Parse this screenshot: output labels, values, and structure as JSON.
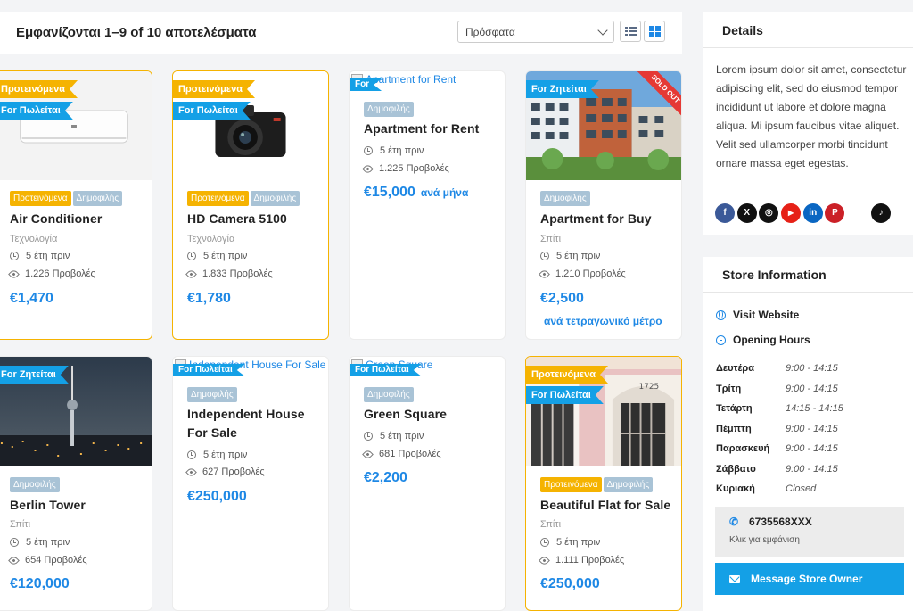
{
  "results": {
    "text": "Εμφανίζονται 1–9 of 10 αποτελέσματα"
  },
  "sort": {
    "selected": "Πρόσφατα"
  },
  "cards": [
    {
      "ribbons": [
        "Προτεινόμενα",
        "For Πωλείται"
      ],
      "tags": [
        "Προτεινόμενα",
        "Δημοφιλής"
      ],
      "title": "Air Conditioner",
      "category": "Τεχνολογία",
      "time": "5 έτη πριν",
      "views": "1.226 Προβολές",
      "price": "€1,470"
    },
    {
      "ribbons": [
        "Προτεινόμενα",
        "For Πωλείται"
      ],
      "tags": [
        "Προτεινόμενα",
        "Δημοφιλής"
      ],
      "title": "HD Camera 5100",
      "category": "Τεχνολογία",
      "time": "5 έτη πριν",
      "views": "1.833 Προβολές",
      "price": "€1,780"
    },
    {
      "broken_alt": "Apartment for Rent",
      "ribbons": [
        "For"
      ],
      "tags": [
        "Δημοφιλής"
      ],
      "title": "Apartment for Rent",
      "time": "5 έτη πριν",
      "views": "1.225 Προβολές",
      "price": "€15,000",
      "price_suffix": "ανά μήνα"
    },
    {
      "ribbons": [
        "For Ζητείται"
      ],
      "badge": "SOLD OUT",
      "tags": [
        "Δημοφιλής"
      ],
      "title": "Apartment for Buy",
      "category": "Σπίτι",
      "time": "5 έτη πριν",
      "views": "1.210 Προβολές",
      "price": "€2,500",
      "price_unit": "ανά τετραγωνικό μέτρο"
    },
    {
      "ribbons": [
        "For Ζητείται"
      ],
      "tags": [
        "Δημοφιλής"
      ],
      "title": "Berlin Tower",
      "category": "Σπίτι",
      "time": "5 έτη πριν",
      "views": "654 Προβολές",
      "price": "€120,000"
    },
    {
      "broken_alt": "Independent House For Sale",
      "ribbons": [
        "For Πωλείται"
      ],
      "tags": [
        "Δημοφιλής"
      ],
      "title_line1": "Independent House",
      "title_line2": "For Sale",
      "time": "5 έτη πριν",
      "views": "627 Προβολές",
      "price": "€250,000"
    },
    {
      "broken_alt": "Green Square",
      "ribbons": [
        "For Πωλείται"
      ],
      "tags": [
        "Δημοφιλής"
      ],
      "title": "Green Square",
      "time": "5 έτη πριν",
      "views": "681 Προβολές",
      "price": "€2,200"
    },
    {
      "ribbons": [
        "Προτεινόμενα",
        "For Πωλείται"
      ],
      "door_number": "1725",
      "tags": [
        "Προτεινόμενα",
        "Δημοφιλής"
      ],
      "title": "Beautiful Flat for Sale",
      "category": "Σπίτι",
      "time": "5 έτη πριν",
      "views": "1.111 Προβολές",
      "price": "€250,000"
    }
  ],
  "details": {
    "heading": "Details",
    "text": "Lorem ipsum dolor sit amet, consectetur adipiscing elit, sed do eiusmod tempor incididunt ut labore et dolore magna aliqua. Mi ipsum faucibus vitae aliquet. Velit sed ullamcorper morbi tincidunt ornare massa eget egestas.",
    "socials": [
      {
        "name": "facebook-icon",
        "glyph": "f",
        "color": "#3b5998"
      },
      {
        "name": "x-icon",
        "glyph": "X",
        "color": "#111111"
      },
      {
        "name": "instagram-icon",
        "glyph": "◎",
        "color": "#111111"
      },
      {
        "name": "youtube-icon",
        "glyph": "▶",
        "color": "#e62117"
      },
      {
        "name": "linkedin-icon",
        "glyph": "in",
        "color": "#0a66c2"
      },
      {
        "name": "pinterest-icon",
        "glyph": "P",
        "color": "#cb2027"
      },
      {
        "name": "tiktok-icon",
        "glyph": "♪",
        "color": "#111111"
      }
    ]
  },
  "store": {
    "heading": "Store Information",
    "visit_website": "Visit Website",
    "opening_hours": "Opening Hours",
    "hours": [
      {
        "day": "Δευτέρα",
        "time": "9:00 - 14:15"
      },
      {
        "day": "Τρίτη",
        "time": "9:00 - 14:15"
      },
      {
        "day": "Τετάρτη",
        "time": "14:15 - 14:15"
      },
      {
        "day": "Πέμπτη",
        "time": "9:00 - 14:15"
      },
      {
        "day": "Παρασκευή",
        "time": "9:00 - 14:15"
      },
      {
        "day": "Σάββατο",
        "time": "9:00 - 14:15"
      },
      {
        "day": "Κυριακή",
        "time": "Closed"
      }
    ],
    "phone": "6735568XXX",
    "phone_hint": "Κλικ για εμφάνιση",
    "message_button": "Message Store Owner"
  },
  "colors": {
    "accent": "#1e88e5",
    "featured": "#f5b301",
    "ribbon_blue": "#14a0e6",
    "sold_out": "#e53935"
  }
}
